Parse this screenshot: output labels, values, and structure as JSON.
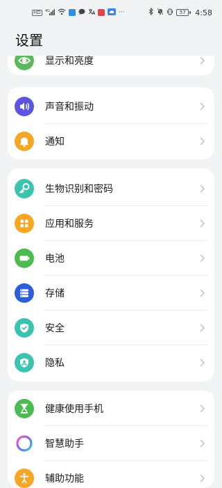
{
  "status_bar": {
    "hd_label": "HD",
    "signal_label": "4G",
    "battery_level": "57",
    "time": "4:58",
    "icons": [
      "hd-icon",
      "signal-icon",
      "wifi-icon",
      "app-icon",
      "message-icon",
      "translate-icon",
      "app-icon",
      "cloud-icon",
      "more-icon",
      "bluetooth-icon",
      "mute-icon",
      "vibrate-icon"
    ]
  },
  "header": {
    "title": "设置"
  },
  "groups": [
    {
      "items": [
        {
          "label": "显示和亮度",
          "icon": "eye-icon",
          "color": "#5cb85c"
        }
      ]
    },
    {
      "items": [
        {
          "label": "声音和振动",
          "icon": "speaker-icon",
          "color": "#5b55e0"
        },
        {
          "label": "通知",
          "icon": "bell-icon",
          "color": "#f5a623"
        }
      ]
    },
    {
      "items": [
        {
          "label": "生物识别和密码",
          "icon": "key-icon",
          "color": "#3cc3b0"
        },
        {
          "label": "应用和服务",
          "icon": "apps-grid-icon",
          "color": "#f5a623"
        },
        {
          "label": "电池",
          "icon": "battery-icon",
          "color": "#4cbb50"
        },
        {
          "label": "存储",
          "icon": "storage-icon",
          "color": "#2b5fd9"
        },
        {
          "label": "安全",
          "icon": "shield-check-icon",
          "color": "#3cc3b0"
        },
        {
          "label": "隐私",
          "icon": "privacy-shield-icon",
          "color": "#3cc3b0"
        }
      ]
    },
    {
      "items": [
        {
          "label": "健康使用手机",
          "icon": "hourglass-icon",
          "color": "#4cbb50"
        },
        {
          "label": "智慧助手",
          "icon": "assistant-ring-icon",
          "color": "#ffffff"
        },
        {
          "label": "辅助功能",
          "icon": "accessibility-icon",
          "color": "#f5a623"
        }
      ]
    }
  ]
}
